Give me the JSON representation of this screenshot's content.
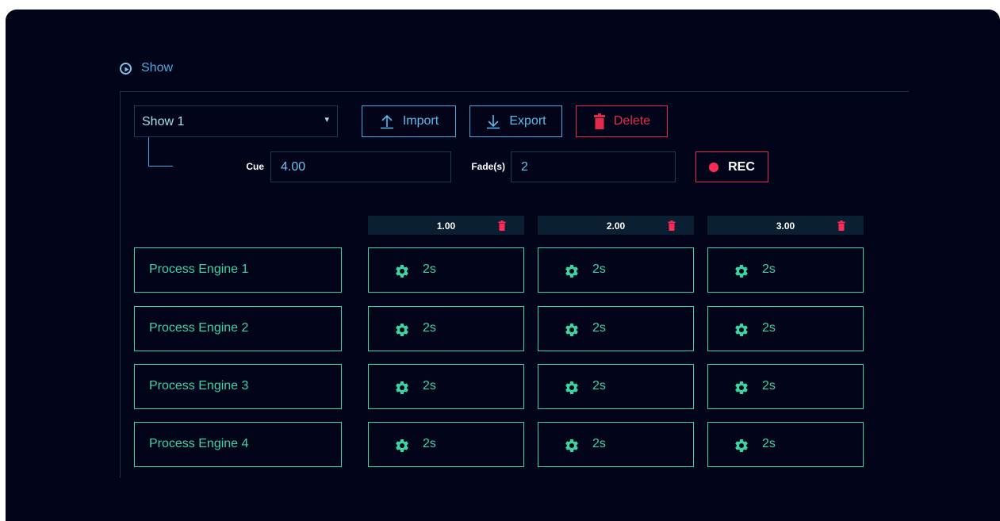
{
  "header": {
    "title": "Show",
    "icon": "play-circle-icon"
  },
  "show_select": {
    "value": "Show 1",
    "caret": "▾"
  },
  "toolbar": {
    "import_label": "Import",
    "export_label": "Export",
    "delete_label": "Delete"
  },
  "cue": {
    "label": "Cue",
    "value": "4.00"
  },
  "fade": {
    "label": "Fade(s)",
    "value": "2"
  },
  "rec": {
    "label": "REC"
  },
  "columns": [
    {
      "label": "1.00"
    },
    {
      "label": "2.00"
    },
    {
      "label": "3.00"
    }
  ],
  "rows": [
    {
      "label": "Process Engine 1",
      "cells": [
        "2s",
        "2s",
        "2s"
      ]
    },
    {
      "label": "Process Engine 2",
      "cells": [
        "2s",
        "2s",
        "2s"
      ]
    },
    {
      "label": "Process Engine 3",
      "cells": [
        "2s",
        "2s",
        "2s"
      ]
    },
    {
      "label": "Process Engine 4",
      "cells": [
        "2s",
        "2s",
        "2s"
      ]
    }
  ],
  "colors": {
    "background": "#02041a",
    "accent_blue": "#4fa9e0",
    "accent_green": "#3ad6a2",
    "danger_red": "#e8284a"
  }
}
